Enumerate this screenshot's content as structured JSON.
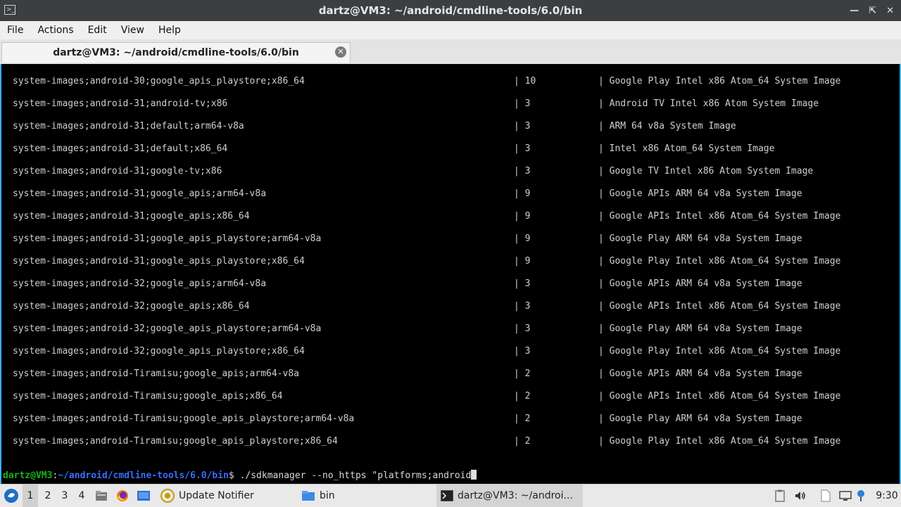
{
  "window": {
    "title": "dartz@VM3: ~/android/cmdline-tools/6.0/bin"
  },
  "menu": {
    "items": [
      "File",
      "Actions",
      "Edit",
      "View",
      "Help"
    ]
  },
  "tab": {
    "label": "dartz@VM3: ~/android/cmdline-tools/6.0/bin"
  },
  "terminal": {
    "rows": [
      [
        "system-images;android-30;google_apis_playstore;x86_64",
        "| 10",
        "| Google Play Intel x86 Atom_64 System Image"
      ],
      [
        "system-images;android-31;android-tv;x86",
        "| 3",
        "| Android TV Intel x86 Atom System Image"
      ],
      [
        "system-images;android-31;default;arm64-v8a",
        "| 3",
        "| ARM 64 v8a System Image"
      ],
      [
        "system-images;android-31;default;x86_64",
        "| 3",
        "| Intel x86 Atom_64 System Image"
      ],
      [
        "system-images;android-31;google-tv;x86",
        "| 3",
        "| Google TV Intel x86 Atom System Image"
      ],
      [
        "system-images;android-31;google_apis;arm64-v8a",
        "| 9",
        "| Google APIs ARM 64 v8a System Image"
      ],
      [
        "system-images;android-31;google_apis;x86_64",
        "| 9",
        "| Google APIs Intel x86 Atom_64 System Image"
      ],
      [
        "system-images;android-31;google_apis_playstore;arm64-v8a",
        "| 9",
        "| Google Play ARM 64 v8a System Image"
      ],
      [
        "system-images;android-31;google_apis_playstore;x86_64",
        "| 9",
        "| Google Play Intel x86 Atom_64 System Image"
      ],
      [
        "system-images;android-32;google_apis;arm64-v8a",
        "| 3",
        "| Google APIs ARM 64 v8a System Image"
      ],
      [
        "system-images;android-32;google_apis;x86_64",
        "| 3",
        "| Google APIs Intel x86 Atom_64 System Image"
      ],
      [
        "system-images;android-32;google_apis_playstore;arm64-v8a",
        "| 3",
        "| Google Play ARM 64 v8a System Image"
      ],
      [
        "system-images;android-32;google_apis_playstore;x86_64",
        "| 3",
        "| Google Play Intel x86 Atom_64 System Image"
      ],
      [
        "system-images;android-Tiramisu;google_apis;arm64-v8a",
        "| 2",
        "| Google APIs ARM 64 v8a System Image"
      ],
      [
        "system-images;android-Tiramisu;google_apis;x86_64",
        "| 2",
        "| Google APIs Intel x86 Atom_64 System Image"
      ],
      [
        "system-images;android-Tiramisu;google_apis_playstore;arm64-v8a",
        "| 2",
        "| Google Play ARM 64 v8a System Image"
      ],
      [
        "system-images;android-Tiramisu;google_apis_playstore;x86_64",
        "| 2",
        "| Google Play Intel x86 Atom_64 System Image"
      ]
    ],
    "prompt_user": "dartz@VM3",
    "prompt_sep": ":",
    "prompt_path": "~/android/cmdline-tools/6.0/bin",
    "prompt_symbol": "$ ",
    "command": "./sdkmanager --no_https \"platforms;android"
  },
  "taskbar": {
    "desktops": [
      "1",
      "2",
      "3",
      "4"
    ],
    "tasks": [
      {
        "label": "Update Notifier"
      },
      {
        "label": "bin"
      },
      {
        "label": "dartz@VM3: ~/androi..."
      }
    ],
    "clock": "9:30"
  },
  "colors": {
    "prompt_user": "#18b218",
    "prompt_path": "#3a6cff",
    "accent": "#3daee9"
  }
}
